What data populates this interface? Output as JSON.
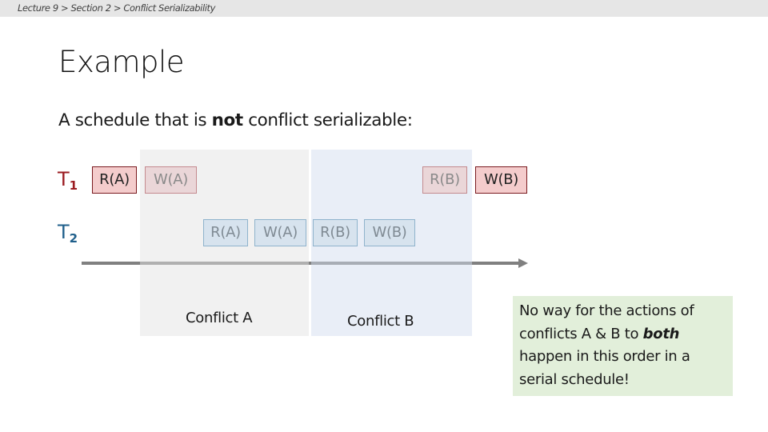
{
  "breadcrumb": {
    "text": "Lecture 9 > Section 2 > Conflict Serializability"
  },
  "slide": {
    "title": "Example",
    "subtitle_prefix": "A schedule that is ",
    "subtitle_bold": "not",
    "subtitle_suffix": " conflict serializable:"
  },
  "transactions": [
    {
      "label": "T",
      "subscript": "1",
      "color": "#9b1c22"
    },
    {
      "label": "T",
      "subscript": "2",
      "color": "#1f5f8b"
    }
  ],
  "operations": {
    "t1": [
      {
        "label": "R(A)",
        "style": "red"
      },
      {
        "label": "W(A)",
        "style": "red-faded"
      },
      {
        "label": "R(B)",
        "style": "red-faded"
      },
      {
        "label": "W(B)",
        "style": "red"
      }
    ],
    "t2": [
      {
        "label": "R(A)",
        "style": "blue"
      },
      {
        "label": "W(A)",
        "style": "blue"
      },
      {
        "label": "R(B)",
        "style": "blue"
      },
      {
        "label": "W(B)",
        "style": "blue"
      }
    ]
  },
  "regions": {
    "a_label": "Conflict A",
    "b_label": "Conflict B"
  },
  "note": {
    "line1": "No way for the actions of",
    "line2_prefix": "conflicts A & B to ",
    "line2_emph": "both",
    "line3": "happen in this order in a",
    "line4": "serial schedule!"
  },
  "colors": {
    "t1_accent": "#9b1c22",
    "t2_accent": "#1f5f8b",
    "conflict_a_bg": "#f1f1f1",
    "conflict_b_bg": "#e9eef7",
    "note_bg": "#e2efda"
  }
}
